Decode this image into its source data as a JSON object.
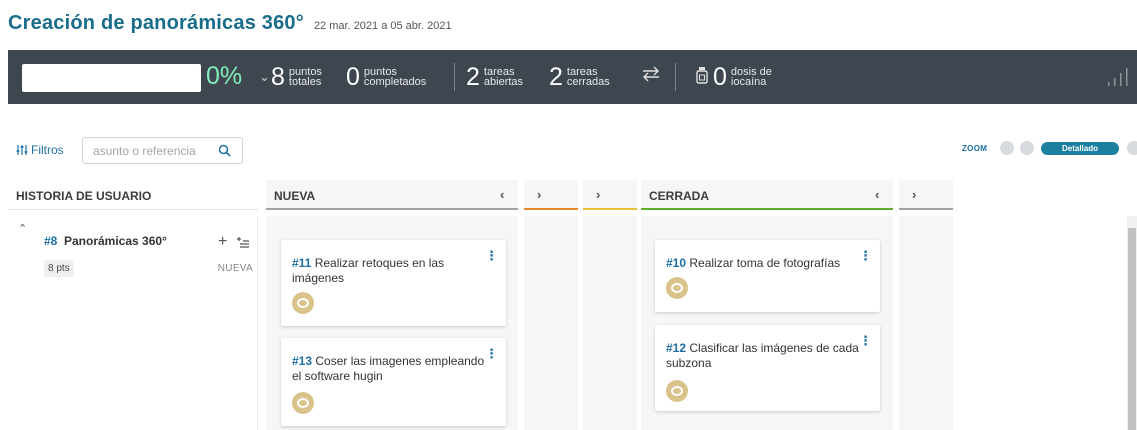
{
  "header": {
    "title": "Creación de panorámicas 360°",
    "dates": "22 mar. 2021 a 05 abr. 2021"
  },
  "stats": {
    "progress": 0,
    "percent": "0%",
    "total_points": {
      "num": "8",
      "l1": "puntos",
      "l2": "totales"
    },
    "completed_points": {
      "num": "0",
      "l1": "puntos",
      "l2": "completados"
    },
    "open_tasks": {
      "num": "2",
      "l1": "tareas",
      "l2": "abiertas"
    },
    "closed_tasks": {
      "num": "2",
      "l1": "tareas",
      "l2": "cerradas"
    },
    "iocaine": {
      "num": "0",
      "l1": "dosis de",
      "l2": "iocaína"
    },
    "colors": {
      "bar": "#3e4650",
      "accent": "#83edb9"
    }
  },
  "toolbar": {
    "filters_label": "Filtros",
    "search_placeholder": "asunto o referencia",
    "zoom_label": "ZOOM",
    "zoom_active": "Detallado"
  },
  "columns": {
    "history_header": "HISTORIA DE USUARIO",
    "new": "NUEVA",
    "closed": "CERRADA",
    "colors": {
      "new": "#a3a3a3",
      "orange": "#e68a2e",
      "yellow": "#e6c232",
      "closed": "#5fad2c"
    }
  },
  "story": {
    "ref": "#8",
    "name": "Panorámicas 360°",
    "points": "8 pts",
    "status": "NUEVA"
  },
  "cards": {
    "c11": {
      "ref": "#11",
      "text": "Realizar retoques en las imágenes"
    },
    "c13": {
      "ref": "#13",
      "text": "Coser las imagenes empleando el software hugin"
    },
    "c10": {
      "ref": "#10",
      "text": "Realizar toma de fotografías"
    },
    "c12": {
      "ref": "#12",
      "text": "Clasificar las imágenes de cada subzona"
    }
  },
  "icons": {
    "chevron": "chevron-down-icon",
    "swap": "swap-arrows-icon",
    "vial": "iocaine-vial-icon",
    "bars": "signal-bars-icon",
    "filters": "sliders-icon",
    "search": "search-icon"
  }
}
